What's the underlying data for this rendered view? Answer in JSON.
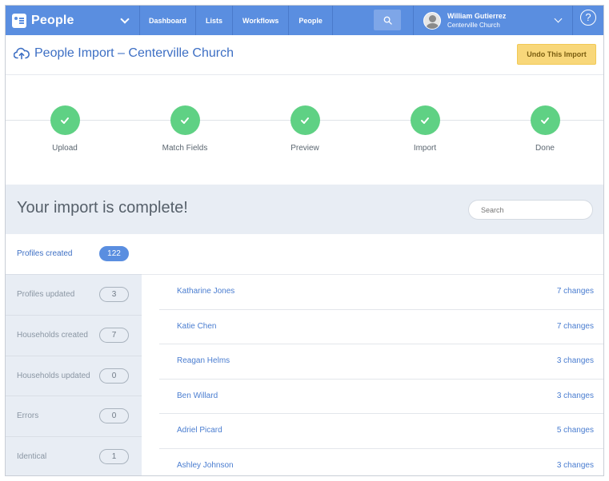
{
  "app": {
    "name": "People"
  },
  "nav": {
    "links": [
      "Dashboard",
      "Lists",
      "Workflows",
      "People"
    ]
  },
  "user": {
    "name": "William Gutierrez",
    "org": "Centerville Church"
  },
  "help_label": "?",
  "header": {
    "title": "People Import – Centerville Church",
    "undo_label": "Undo This Import"
  },
  "steps": [
    "Upload",
    "Match Fields",
    "Preview",
    "Import",
    "Done"
  ],
  "banner": {
    "title": "Your import is complete!",
    "search_placeholder": "Search"
  },
  "stats": [
    {
      "label": "Profiles created",
      "count": "122"
    },
    {
      "label": "Profiles updated",
      "count": "3"
    },
    {
      "label": "Households created",
      "count": "7"
    },
    {
      "label": "Households updated",
      "count": "0"
    },
    {
      "label": "Errors",
      "count": "0"
    },
    {
      "label": "Identical",
      "count": "1"
    }
  ],
  "profiles": [
    {
      "name": "Katharine Jones",
      "changes": "7 changes"
    },
    {
      "name": "Katie Chen",
      "changes": "7 changes"
    },
    {
      "name": "Reagan Helms",
      "changes": "3 changes"
    },
    {
      "name": "Ben Willard",
      "changes": "3 changes"
    },
    {
      "name": "Adriel Picard",
      "changes": "5 changes"
    },
    {
      "name": "Ashley Johnson",
      "changes": "3 changes"
    }
  ],
  "colors": {
    "nav_bg": "#5a8ee0",
    "accent": "#3d6fc4",
    "success": "#5fd184",
    "warning": "#f8d77a"
  }
}
